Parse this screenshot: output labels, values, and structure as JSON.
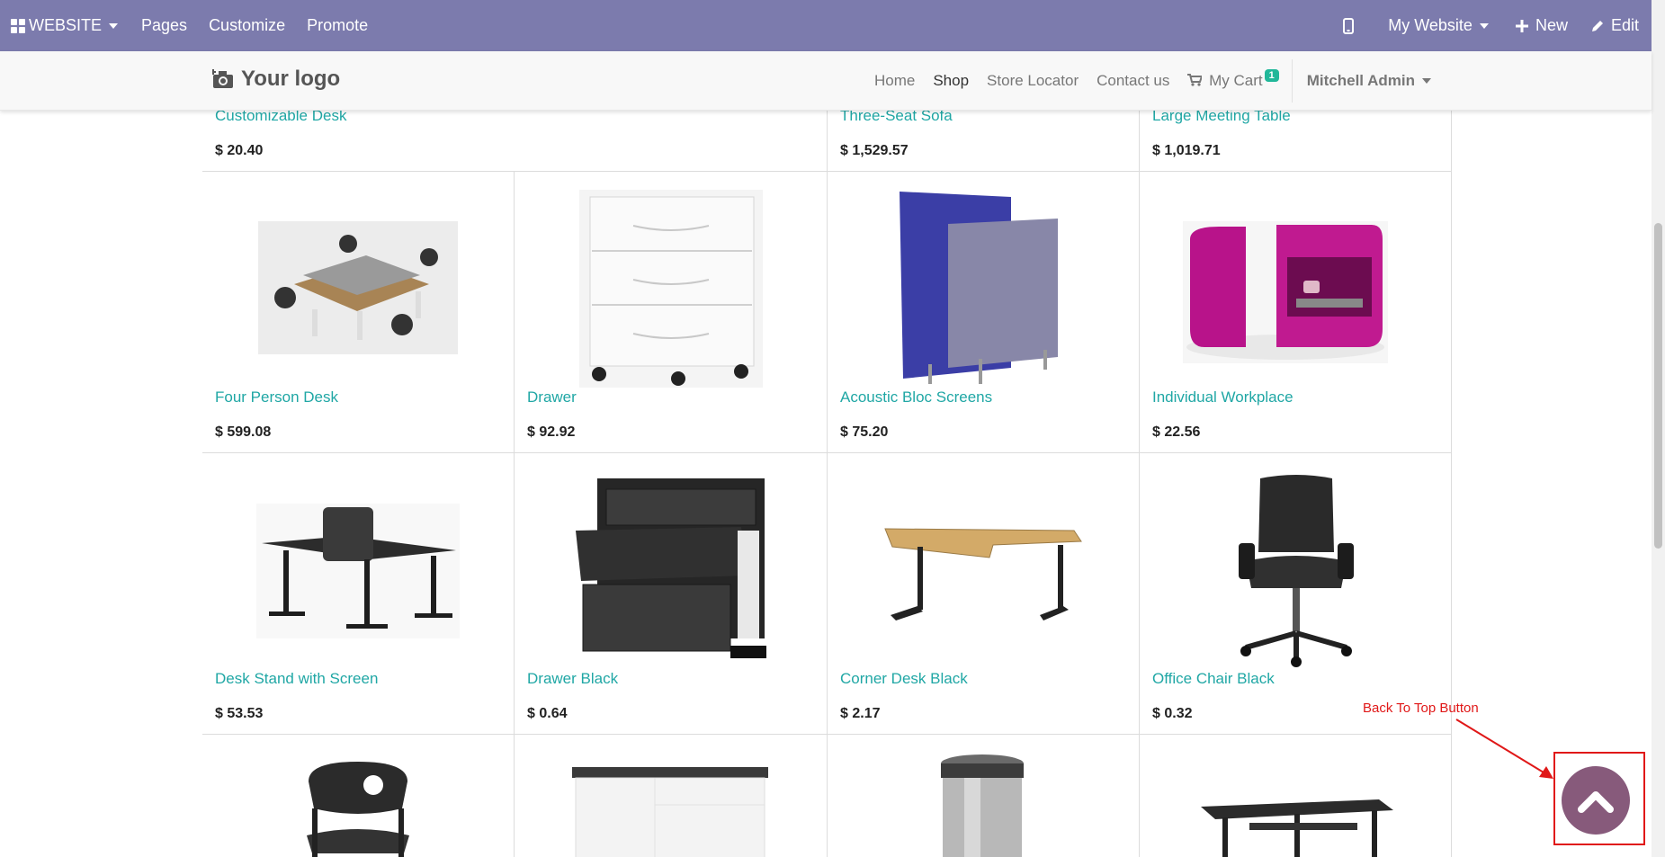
{
  "admin_bar": {
    "apps_label": "WEBSITE",
    "menus": [
      "Pages",
      "Customize",
      "Promote"
    ],
    "website_switch": "My Website",
    "new_label": "New",
    "edit_label": "Edit"
  },
  "navbar": {
    "logo_text": "Your logo",
    "links": [
      {
        "label": "Home",
        "active": false
      },
      {
        "label": "Shop",
        "active": true
      },
      {
        "label": "Store Locator",
        "active": false
      },
      {
        "label": "Contact us",
        "active": false
      }
    ],
    "cart_label": "My Cart",
    "cart_count": "1",
    "user_label": "Mitchell Admin"
  },
  "products": {
    "row1": [
      {
        "name": "Customizable Desk",
        "price": "$ 20.40"
      },
      {
        "name": "Three-Seat Sofa",
        "price": "$ 1,529.57"
      },
      {
        "name": "Large Meeting Table",
        "price": "$ 1,019.71"
      }
    ],
    "row2": [
      {
        "name": "Four Person Desk",
        "price": "$ 599.08"
      },
      {
        "name": "Drawer",
        "price": "$ 92.92"
      },
      {
        "name": "Acoustic Bloc Screens",
        "price": "$ 75.20"
      },
      {
        "name": "Individual Workplace",
        "price": "$ 22.56"
      }
    ],
    "row3": [
      {
        "name": "Desk Stand with Screen",
        "price": "$ 53.53"
      },
      {
        "name": "Drawer Black",
        "price": "$ 0.64"
      },
      {
        "name": "Corner Desk Black",
        "price": "$ 2.17"
      },
      {
        "name": "Office Chair Black",
        "price": "$ 0.32"
      }
    ]
  },
  "annotation": {
    "label": "Back To Top Button"
  },
  "colors": {
    "admin_bar": "#7c7bad",
    "link": "#20a7a5",
    "back_to_top": "#875a7b",
    "annotation": "#e01818"
  }
}
